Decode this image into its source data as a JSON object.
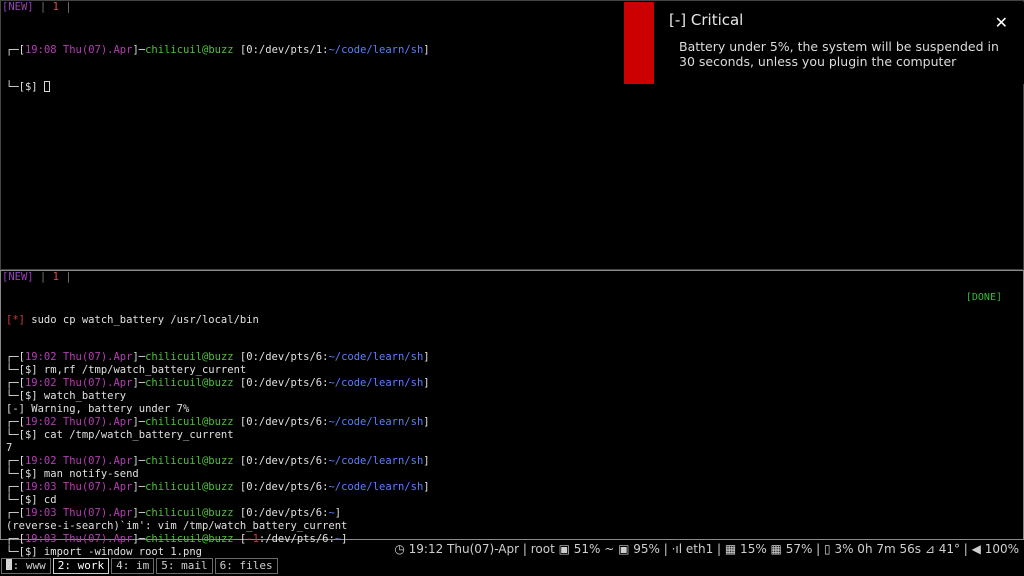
{
  "pane_top": {
    "tabline": {
      "new": "[NEW]",
      "sep1": " | ",
      "num": "1",
      "sep2": " |"
    },
    "prompt": {
      "corner": "┌─",
      "open": "[",
      "time": "19:08 Thu(07).Apr",
      "user": "chilicuil@buzz",
      "open2": " [",
      "tty": "0:/dev/pts/1:",
      "path": "~/code/learn/sh",
      "close": "]",
      "cmd_prefix": "└─[$] "
    }
  },
  "notification": {
    "title": "[-] Critical",
    "body": "Battery under 5%, the system will be suspended in 30 seconds, unless you plugin the computer",
    "close_icon": "✕",
    "urgency_color": "#cc0000"
  },
  "pane_bottom": {
    "tabline": {
      "new": "[NEW]",
      "sep1": " | ",
      "num": "1",
      "sep2": " |"
    },
    "done_label": "[DONE]",
    "first_line": {
      "marker": "[*]",
      "cmd": " sudo cp watch_battery /usr/local/bin"
    },
    "blocks": [
      {
        "time": "19:02 Thu(07).Apr",
        "user": "chilicuil@buzz",
        "tty": "0:/dev/pts/6:",
        "path": "~/code/learn/sh",
        "cmd": "rm,rf /tmp/watch_battery_current",
        "output": ""
      },
      {
        "time": "19:02 Thu(07).Apr",
        "user": "chilicuil@buzz",
        "tty": "0:/dev/pts/6:",
        "path": "~/code/learn/sh",
        "cmd": "watch_battery",
        "output": "[-] Warning, battery under 7%"
      },
      {
        "time": "19:02 Thu(07).Apr",
        "user": "chilicuil@buzz",
        "tty": "0:/dev/pts/6:",
        "path": "~/code/learn/sh",
        "cmd": "cat /tmp/watch_battery_current",
        "output": "7"
      },
      {
        "time": "19:02 Thu(07).Apr",
        "user": "chilicuil@buzz",
        "tty": "0:/dev/pts/6:",
        "path": "~/code/learn/sh",
        "cmd": "man notify-send",
        "output": ""
      },
      {
        "time": "19:03 Thu(07).Apr",
        "user": "chilicuil@buzz",
        "tty": "0:/dev/pts/6:",
        "path": "~/code/learn/sh",
        "cmd": "cd",
        "output": ""
      }
    ],
    "search_block": {
      "time": "19:03 Thu(07).Apr",
      "user": "chilicuil@buzz",
      "tty": "0:/dev/pts/6:",
      "path": "~",
      "search_line": "(reverse-i-search)`im': vim /tmp/watch_battery_current"
    },
    "last_block": {
      "time": "19:03 Thu(07).Apr",
      "user": "chilicuil@buzz",
      "tty_code": "-1",
      "tty": ":/dev/pts/6:",
      "path": "~",
      "cmd": "import -window root 1.png"
    }
  },
  "statusbar": {
    "text": "◷ 19:12 Thu(07)-Apr | root ▣ 51% ~ ▣ 95% | ⋅ıl eth1 | ▦ 15% ▦ 57% | ▯ 3% 0h 7m 56s ⊿ 41° | ◀ 100%"
  },
  "workspaces": [
    {
      "label": "1: www",
      "active": false
    },
    {
      "label": "2: work",
      "active": true
    },
    {
      "label": "4: im",
      "active": false
    },
    {
      "label": "5: mail",
      "active": false
    },
    {
      "label": "6: files",
      "active": false
    }
  ]
}
